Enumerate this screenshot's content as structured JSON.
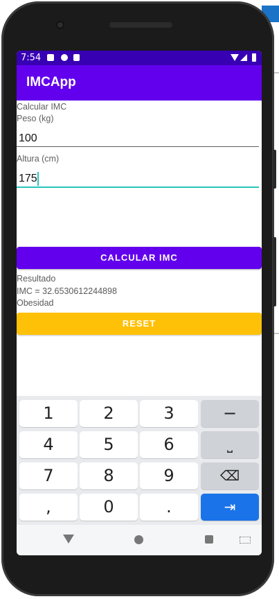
{
  "status": {
    "time": "7:54"
  },
  "app": {
    "title": "IMCApp",
    "primary_color": "#6200ee",
    "status_color": "#3700b3",
    "accent_color": "#26c6b9"
  },
  "form": {
    "header": "Calcular IMC",
    "peso_label": "Peso (kg)",
    "peso_value": "100",
    "altura_label": "Altura (cm)",
    "altura_value": "175"
  },
  "buttons": {
    "calc_label": "CALCULAR IMC",
    "reset_label": "RESET",
    "reset_color": "#ffc107"
  },
  "result": {
    "title": "Resultado",
    "value": "IMC = 32.6530612244898",
    "category": "Obesidad"
  },
  "keyboard": {
    "rows": [
      [
        "1",
        "2",
        "3",
        "−"
      ],
      [
        "4",
        "5",
        "6",
        "⎵"
      ],
      [
        "7",
        "8",
        "9",
        "⌫"
      ],
      [
        ",",
        "0",
        ".",
        "⇥"
      ]
    ],
    "enter_color": "#1a73e8"
  }
}
